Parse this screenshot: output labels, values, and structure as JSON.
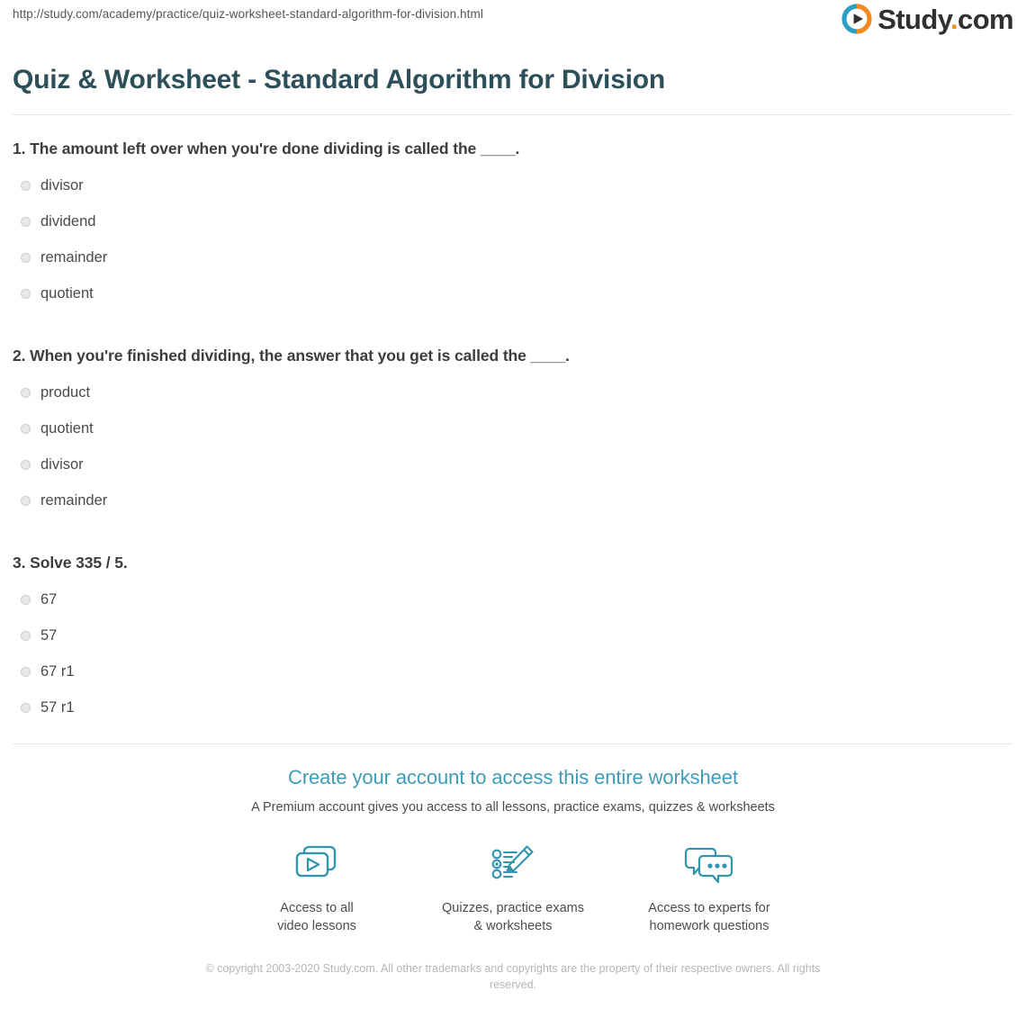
{
  "header": {
    "url": "http://study.com/academy/practice/quiz-worksheet-standard-algorithm-for-division.html",
    "logo": {
      "mark_icon": "play-circle-icon",
      "word_primary": "Study",
      "word_dot": ".",
      "word_secondary": "com",
      "ring_color_top": "#2e9fc4",
      "ring_color_bottom": "#f08a24",
      "text_color": "#2f3031",
      "dot_color": "#f08a24"
    }
  },
  "page_title": "Quiz & Worksheet - Standard Algorithm for Division",
  "title_color": "#2c4f5a",
  "questions": [
    {
      "text": "1. The amount left over when you're done dividing is called the ____.",
      "options": [
        "divisor",
        "dividend",
        "remainder",
        "quotient"
      ]
    },
    {
      "text": "2. When you're finished dividing, the answer that you get is called the ____.",
      "options": [
        "product",
        "quotient",
        "divisor",
        "remainder"
      ]
    },
    {
      "text": "3. Solve 335 / 5.",
      "options": [
        "67",
        "57",
        "67 r1",
        "57 r1"
      ]
    }
  ],
  "cta": {
    "title": "Create your account to access this entire worksheet",
    "title_color": "#3f9cb9",
    "subtitle": "A Premium account gives you access to all lessons, practice exams, quizzes & worksheets",
    "features": [
      {
        "icon": "video-lessons-icon",
        "caption_line1": "Access to all",
        "caption_line2": "video lessons"
      },
      {
        "icon": "quiz-checklist-pencil-icon",
        "caption_line1": "Quizzes, practice exams",
        "caption_line2": "& worksheets"
      },
      {
        "icon": "chat-bubbles-icon",
        "caption_line1": "Access to experts for",
        "caption_line2": "homework questions"
      }
    ],
    "icon_color": "#3195b0"
  },
  "copyright": "© copyright 2003-2020 Study.com. All other trademarks and copyrights are the property of their respective owners. All rights reserved."
}
